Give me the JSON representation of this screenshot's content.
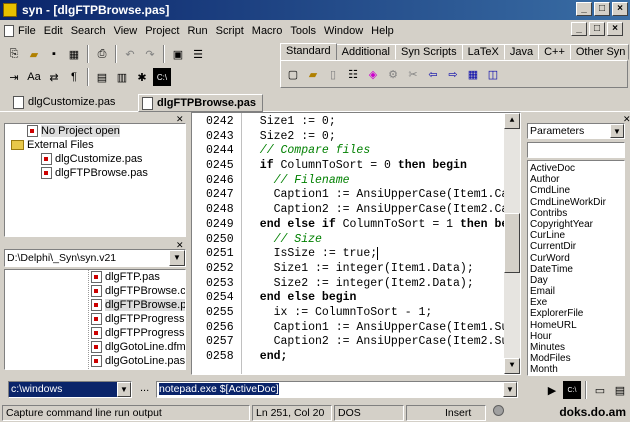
{
  "window": {
    "title": "syn - [dlgFTPBrowse.pas]"
  },
  "menu": [
    "File",
    "Edit",
    "Search",
    "View",
    "Project",
    "Run",
    "Script",
    "Macro",
    "Tools",
    "Window",
    "Help"
  ],
  "palette_tabs": [
    "Standard",
    "Additional",
    "Syn Scripts",
    "LaTeX",
    "Java",
    "C++",
    "Other Syn T"
  ],
  "file_tabs": [
    "dlgCustomize.pas",
    "dlgFTPBrowse.pas"
  ],
  "project_tree": {
    "root": "No Project open",
    "folder": "External Files",
    "files": [
      "dlgCustomize.pas",
      "dlgFTPBrowse.pas"
    ]
  },
  "dir_combo": "D:\\Delphi\\_Syn\\syn.v21",
  "file_list": [
    "dlgFTP.pas",
    "dlgFTPBrowse.c",
    "dlgFTPBrowse.p",
    "dlgFTPProgress",
    "dlgFTPProgress",
    "dlgGotoLine.dfm",
    "dlgGotoLine.pas"
  ],
  "editor": {
    "line_numbers": [
      "0242",
      "0243",
      "0244",
      "0245",
      "0246",
      "0247",
      "0248",
      "0249",
      "0250",
      "0251",
      "0252",
      "0253",
      "0254",
      "0255",
      "0256",
      "0257",
      "0258"
    ],
    "lines": [
      [
        {
          "t": "  Size1 := 0;",
          "c": ""
        }
      ],
      [
        {
          "t": "  Size2 := 0;",
          "c": ""
        }
      ],
      [
        {
          "t": "  // Compare files",
          "c": "cm"
        }
      ],
      [
        {
          "t": "  if ",
          "c": "kw"
        },
        {
          "t": "ColumnToSort = 0 ",
          "c": ""
        },
        {
          "t": "then begin",
          "c": "kw"
        }
      ],
      [
        {
          "t": "    // Filename",
          "c": "cm"
        }
      ],
      [
        {
          "t": "    Caption1 := AnsiUpperCase(Item1.Ca",
          "c": ""
        }
      ],
      [
        {
          "t": "    Caption2 := AnsiUpperCase(Item2.Ca",
          "c": ""
        }
      ],
      [
        {
          "t": "  end else if ",
          "c": "kw"
        },
        {
          "t": "ColumnToSort = 1 ",
          "c": ""
        },
        {
          "t": "then be",
          "c": "kw"
        }
      ],
      [
        {
          "t": "    // Size",
          "c": "cm"
        }
      ],
      [
        {
          "t": "    IsSize := true;",
          "c": ""
        }
      ],
      [
        {
          "t": "    Size1 := integer(Item1.Data);",
          "c": ""
        }
      ],
      [
        {
          "t": "    Size2 := integer(Item2.Data);",
          "c": ""
        }
      ],
      [
        {
          "t": "  end else begin",
          "c": "kw"
        }
      ],
      [
        {
          "t": "    ix := ColumnToSort - 1;",
          "c": ""
        }
      ],
      [
        {
          "t": "    Caption1 := AnsiUpperCase(Item1.Su",
          "c": ""
        }
      ],
      [
        {
          "t": "    Caption2 := AnsiUpperCase(Item2.Su",
          "c": ""
        }
      ],
      [
        {
          "t": "  end;",
          "c": "kw"
        }
      ]
    ]
  },
  "params": {
    "selected": "Parameters",
    "items": [
      "ActiveDoc",
      "Author",
      "CmdLine",
      "CmdLineWorkDir",
      "Contribs",
      "CopyrightYear",
      "CurLine",
      "CurrentDir",
      "CurWord",
      "DateTime",
      "Day",
      "Email",
      "Exe",
      "ExplorerFile",
      "HomeURL",
      "Hour",
      "Minutes",
      "ModFiles",
      "Month"
    ]
  },
  "commandline": {
    "dir": "c:\\windows",
    "ellipsis": "...",
    "cmd": "notepad.exe $[ActiveDoc]"
  },
  "status": {
    "hint": "Capture command line run output",
    "pos": "Ln 251, Col 20",
    "mode": "DOS",
    "insert": "Insert",
    "watermark": "doks.do.am"
  },
  "colors": {
    "title_start": "#0a246a",
    "title_end": "#3a6ea5",
    "selection": "#0a246a",
    "comment": "#008000"
  }
}
